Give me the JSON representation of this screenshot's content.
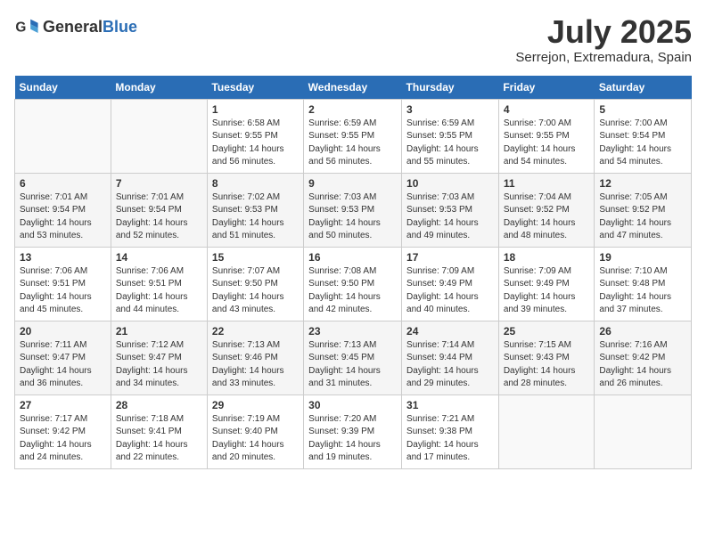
{
  "header": {
    "logo_general": "General",
    "logo_blue": "Blue",
    "month_year": "July 2025",
    "location": "Serrejon, Extremadura, Spain"
  },
  "days_of_week": [
    "Sunday",
    "Monday",
    "Tuesday",
    "Wednesday",
    "Thursday",
    "Friday",
    "Saturday"
  ],
  "weeks": [
    [
      {
        "day": "",
        "sunrise": "",
        "sunset": "",
        "daylight": "",
        "empty": true
      },
      {
        "day": "",
        "sunrise": "",
        "sunset": "",
        "daylight": "",
        "empty": true
      },
      {
        "day": "1",
        "sunrise": "Sunrise: 6:58 AM",
        "sunset": "Sunset: 9:55 PM",
        "daylight": "Daylight: 14 hours and 56 minutes."
      },
      {
        "day": "2",
        "sunrise": "Sunrise: 6:59 AM",
        "sunset": "Sunset: 9:55 PM",
        "daylight": "Daylight: 14 hours and 56 minutes."
      },
      {
        "day": "3",
        "sunrise": "Sunrise: 6:59 AM",
        "sunset": "Sunset: 9:55 PM",
        "daylight": "Daylight: 14 hours and 55 minutes."
      },
      {
        "day": "4",
        "sunrise": "Sunrise: 7:00 AM",
        "sunset": "Sunset: 9:55 PM",
        "daylight": "Daylight: 14 hours and 54 minutes."
      },
      {
        "day": "5",
        "sunrise": "Sunrise: 7:00 AM",
        "sunset": "Sunset: 9:54 PM",
        "daylight": "Daylight: 14 hours and 54 minutes."
      }
    ],
    [
      {
        "day": "6",
        "sunrise": "Sunrise: 7:01 AM",
        "sunset": "Sunset: 9:54 PM",
        "daylight": "Daylight: 14 hours and 53 minutes."
      },
      {
        "day": "7",
        "sunrise": "Sunrise: 7:01 AM",
        "sunset": "Sunset: 9:54 PM",
        "daylight": "Daylight: 14 hours and 52 minutes."
      },
      {
        "day": "8",
        "sunrise": "Sunrise: 7:02 AM",
        "sunset": "Sunset: 9:53 PM",
        "daylight": "Daylight: 14 hours and 51 minutes."
      },
      {
        "day": "9",
        "sunrise": "Sunrise: 7:03 AM",
        "sunset": "Sunset: 9:53 PM",
        "daylight": "Daylight: 14 hours and 50 minutes."
      },
      {
        "day": "10",
        "sunrise": "Sunrise: 7:03 AM",
        "sunset": "Sunset: 9:53 PM",
        "daylight": "Daylight: 14 hours and 49 minutes."
      },
      {
        "day": "11",
        "sunrise": "Sunrise: 7:04 AM",
        "sunset": "Sunset: 9:52 PM",
        "daylight": "Daylight: 14 hours and 48 minutes."
      },
      {
        "day": "12",
        "sunrise": "Sunrise: 7:05 AM",
        "sunset": "Sunset: 9:52 PM",
        "daylight": "Daylight: 14 hours and 47 minutes."
      }
    ],
    [
      {
        "day": "13",
        "sunrise": "Sunrise: 7:06 AM",
        "sunset": "Sunset: 9:51 PM",
        "daylight": "Daylight: 14 hours and 45 minutes."
      },
      {
        "day": "14",
        "sunrise": "Sunrise: 7:06 AM",
        "sunset": "Sunset: 9:51 PM",
        "daylight": "Daylight: 14 hours and 44 minutes."
      },
      {
        "day": "15",
        "sunrise": "Sunrise: 7:07 AM",
        "sunset": "Sunset: 9:50 PM",
        "daylight": "Daylight: 14 hours and 43 minutes."
      },
      {
        "day": "16",
        "sunrise": "Sunrise: 7:08 AM",
        "sunset": "Sunset: 9:50 PM",
        "daylight": "Daylight: 14 hours and 42 minutes."
      },
      {
        "day": "17",
        "sunrise": "Sunrise: 7:09 AM",
        "sunset": "Sunset: 9:49 PM",
        "daylight": "Daylight: 14 hours and 40 minutes."
      },
      {
        "day": "18",
        "sunrise": "Sunrise: 7:09 AM",
        "sunset": "Sunset: 9:49 PM",
        "daylight": "Daylight: 14 hours and 39 minutes."
      },
      {
        "day": "19",
        "sunrise": "Sunrise: 7:10 AM",
        "sunset": "Sunset: 9:48 PM",
        "daylight": "Daylight: 14 hours and 37 minutes."
      }
    ],
    [
      {
        "day": "20",
        "sunrise": "Sunrise: 7:11 AM",
        "sunset": "Sunset: 9:47 PM",
        "daylight": "Daylight: 14 hours and 36 minutes."
      },
      {
        "day": "21",
        "sunrise": "Sunrise: 7:12 AM",
        "sunset": "Sunset: 9:47 PM",
        "daylight": "Daylight: 14 hours and 34 minutes."
      },
      {
        "day": "22",
        "sunrise": "Sunrise: 7:13 AM",
        "sunset": "Sunset: 9:46 PM",
        "daylight": "Daylight: 14 hours and 33 minutes."
      },
      {
        "day": "23",
        "sunrise": "Sunrise: 7:13 AM",
        "sunset": "Sunset: 9:45 PM",
        "daylight": "Daylight: 14 hours and 31 minutes."
      },
      {
        "day": "24",
        "sunrise": "Sunrise: 7:14 AM",
        "sunset": "Sunset: 9:44 PM",
        "daylight": "Daylight: 14 hours and 29 minutes."
      },
      {
        "day": "25",
        "sunrise": "Sunrise: 7:15 AM",
        "sunset": "Sunset: 9:43 PM",
        "daylight": "Daylight: 14 hours and 28 minutes."
      },
      {
        "day": "26",
        "sunrise": "Sunrise: 7:16 AM",
        "sunset": "Sunset: 9:42 PM",
        "daylight": "Daylight: 14 hours and 26 minutes."
      }
    ],
    [
      {
        "day": "27",
        "sunrise": "Sunrise: 7:17 AM",
        "sunset": "Sunset: 9:42 PM",
        "daylight": "Daylight: 14 hours and 24 minutes."
      },
      {
        "day": "28",
        "sunrise": "Sunrise: 7:18 AM",
        "sunset": "Sunset: 9:41 PM",
        "daylight": "Daylight: 14 hours and 22 minutes."
      },
      {
        "day": "29",
        "sunrise": "Sunrise: 7:19 AM",
        "sunset": "Sunset: 9:40 PM",
        "daylight": "Daylight: 14 hours and 20 minutes."
      },
      {
        "day": "30",
        "sunrise": "Sunrise: 7:20 AM",
        "sunset": "Sunset: 9:39 PM",
        "daylight": "Daylight: 14 hours and 19 minutes."
      },
      {
        "day": "31",
        "sunrise": "Sunrise: 7:21 AM",
        "sunset": "Sunset: 9:38 PM",
        "daylight": "Daylight: 14 hours and 17 minutes."
      },
      {
        "day": "",
        "sunrise": "",
        "sunset": "",
        "daylight": "",
        "empty": true
      },
      {
        "day": "",
        "sunrise": "",
        "sunset": "",
        "daylight": "",
        "empty": true
      }
    ]
  ]
}
